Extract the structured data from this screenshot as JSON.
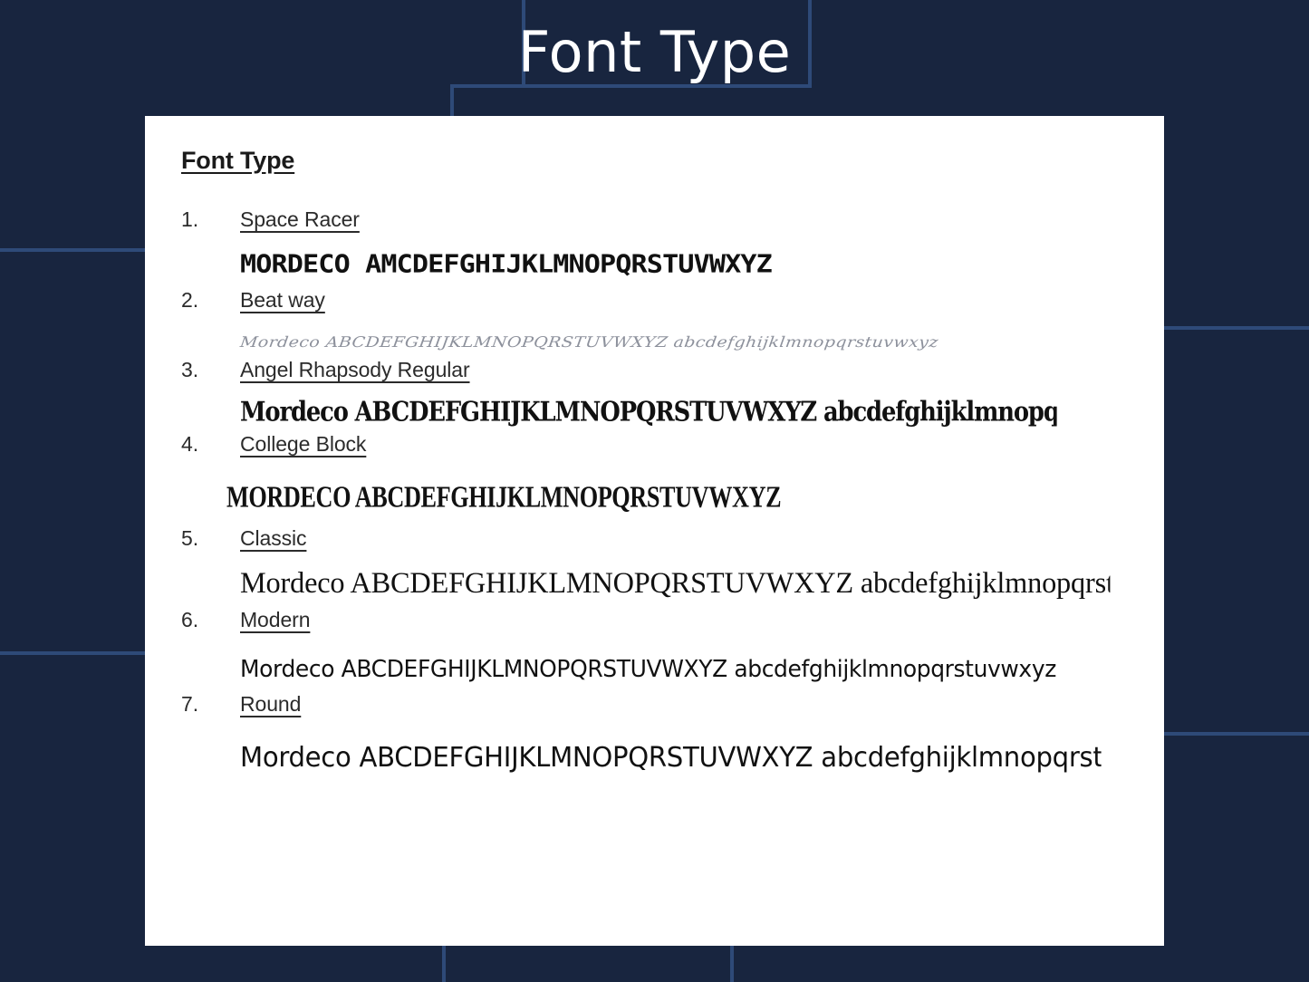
{
  "slide": {
    "title": "Font Type",
    "background_color": "#18253f",
    "accent_line_color": "#2e4a78",
    "card_color": "#ffffff"
  },
  "document": {
    "heading": "Font Type",
    "entries": [
      {
        "number": "1.",
        "name": "Space Racer",
        "specimen": "MORDECO  AMCDEFGHIJKLMNOPQRSTUVWXYZ"
      },
      {
        "number": "2.",
        "name": "Beat way",
        "specimen": "Mordeco ABCDEFGHIJKLMNOPQRSTUVWXYZ abcdefghijklmnopqrstuvwxyz"
      },
      {
        "number": "3.",
        "name": "Angel Rhapsody Regular",
        "specimen": "Mordeco ABCDEFGHIJKLMNOPQRSTUVWXYZ abcdefghijklmnopqrstuvwxyz"
      },
      {
        "number": "4.",
        "name": "College Block",
        "specimen": "MORDECO ABCDEFGHIJKLMNOPQRSTUVWXYZ"
      },
      {
        "number": "5.",
        "name": "Classic",
        "specimen": "Mordeco ABCDEFGHIJKLMNOPQRSTUVWXYZ abcdefghijklmnopqrstuvwxyz"
      },
      {
        "number": "6.",
        "name": "Modern",
        "specimen": "Mordeco ABCDEFGHIJKLMNOPQRSTUVWXYZ abcdefghijklmnopqrstuvwxyz"
      },
      {
        "number": "7.",
        "name": "Round",
        "specimen": "Mordeco ABCDEFGHIJKLMNOPQRSTUVWXYZ abcdefghijklmnopqrstuvwxyz"
      }
    ]
  }
}
